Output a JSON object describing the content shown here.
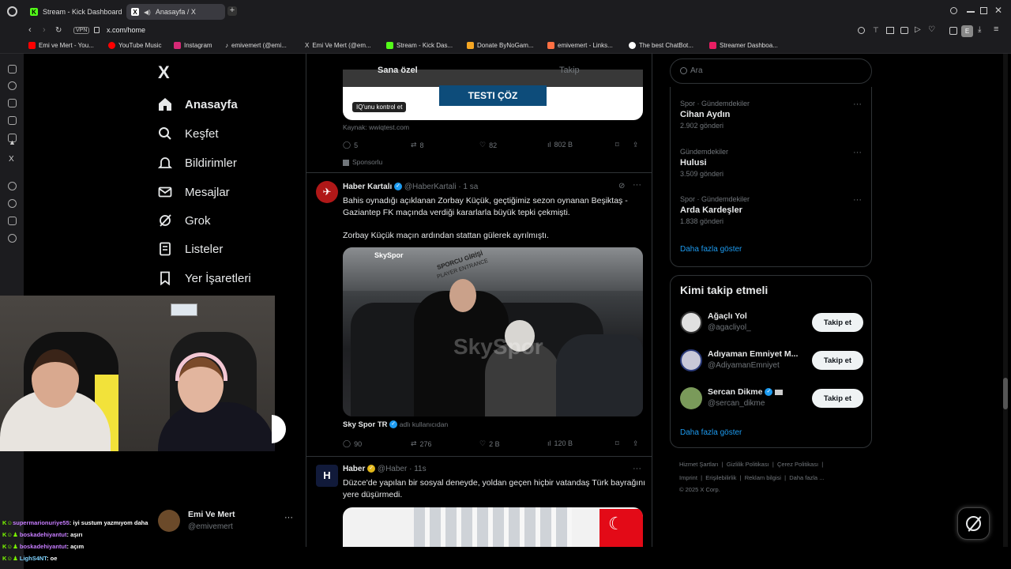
{
  "browser": {
    "tabs": [
      {
        "label": "Stream - Kick Dashboard",
        "active": false
      },
      {
        "label": "Anasayfa / X",
        "active": true
      }
    ],
    "url": "x.com/home",
    "vpn_label": "VPN",
    "profile_initial": "E",
    "bookmarks": [
      {
        "label": "Emi ve Mert - You...",
        "color": "#ff0000"
      },
      {
        "label": "YouTube Music",
        "color": "#ff0000"
      },
      {
        "label": "Instagram",
        "color": "#d62976"
      },
      {
        "label": "emivemert (@emi...",
        "color": "#ffffff"
      },
      {
        "label": "Emi Ve Mert (@em...",
        "color": "#ffffff"
      },
      {
        "label": "Stream - Kick Das...",
        "color": "#53fc18"
      },
      {
        "label": "Donate ByNoGam...",
        "color": "#f5a623"
      },
      {
        "label": "emivemert - Links...",
        "color": "#ff7043"
      },
      {
        "label": "The best ChatBot...",
        "color": "#ffffff"
      },
      {
        "label": "Streamer Dashboa...",
        "color": "#e91e63"
      }
    ]
  },
  "sidebar": {
    "logo": "X",
    "items": [
      {
        "label": "Anasayfa",
        "icon": "home-icon",
        "bold": true
      },
      {
        "label": "Keşfet",
        "icon": "search-icon"
      },
      {
        "label": "Bildirimler",
        "icon": "bell-icon"
      },
      {
        "label": "Mesajlar",
        "icon": "mail-icon"
      },
      {
        "label": "Grok",
        "icon": "grok-icon"
      },
      {
        "label": "Listeler",
        "icon": "list-icon"
      },
      {
        "label": "Yer İşaretleri",
        "icon": "bookmark-icon"
      }
    ]
  },
  "feed": {
    "tabs": [
      {
        "label": "Sana özel",
        "active": true
      },
      {
        "label": "Takip",
        "active": false
      }
    ],
    "ad": {
      "button": "TESTI ÇÖZ",
      "iq_label": "IQ'unu kontrol et",
      "source": "Kaynak: wwiqtest.com",
      "replies": "5",
      "retweets": "8",
      "likes": "82",
      "views": "802 B",
      "sponsored": "Sponsorlu"
    },
    "tweet1": {
      "name": "Haber Kartalı",
      "handle": "@HaberKartali",
      "time": "· 1 sa",
      "text1": "Bahis oynadığı açıklanan Zorbay Küçük, geçtiğimiz sezon oynanan Beşiktaş - Gaziantep FK maçında verdiği kararlarla büyük tepki çekmişti.",
      "text2": "Zorbay Küçük maçın ardından stattan gülerek ayrılmıştı.",
      "media_credit": "Sky Spor TR",
      "media_sub": "adlı kullanıcıdan",
      "watermark": "SkySpor",
      "sign1": "SPORCU GİRİŞİ",
      "sign2": "PLAYER ENTRANCE",
      "replies": "90",
      "retweets": "276",
      "likes": "2 B",
      "views": "120 B"
    },
    "tweet2": {
      "name": "Haber",
      "handle": "@Haber",
      "time": "· 11s",
      "text": "Düzce'de yapılan bir sosyal deneyde, yoldan geçen hiçbir vatandaş Türk bayrağını yere düşürmedi."
    }
  },
  "right": {
    "search_placeholder": "Ara",
    "trends": [
      {
        "meta": "Spor · Gündemdekiler",
        "name": "Cihan Aydın",
        "count": "2.902 gönderi"
      },
      {
        "meta": "Gündemdekiler",
        "name": "Hulusi",
        "count": "3.509 gönderi"
      },
      {
        "meta": "Spor · Gündemdekiler",
        "name": "Arda Kardeşler",
        "count": "1.838 gönderi"
      }
    ],
    "show_more": "Daha fazla göster",
    "who_title": "Kimi takip etmeli",
    "who": [
      {
        "name": "Ağaçlı Yol",
        "handle": "@agacliyol_",
        "button": "Takip et",
        "avatar_color": "#ddd"
      },
      {
        "name": "Adıyaman Emniyet M...",
        "handle": "@AdiyamanEmniyet",
        "button": "Takip et",
        "avatar_color": "#c8c8d8"
      },
      {
        "name": "Sercan Dikme",
        "handle": "@sercan_dikme",
        "button": "Takip et",
        "avatar_color": "#7a9a5a"
      }
    ],
    "who_more": "Daha fazla göster",
    "footer_line1": [
      "Hizmet Şartları",
      "Gizlilik Politikası",
      "Çerez Politikası"
    ],
    "footer_line2": [
      "Imprint",
      "Erişilebilirlik",
      "Reklam bilgisi",
      "Daha fazla ..."
    ],
    "copyright": "© 2025 X Corp."
  },
  "account": {
    "name": "Emi Ve Mert",
    "handle": "@emivemert"
  },
  "chat": [
    {
      "user": "supermarionuriye55",
      "msg": ": iyi sustum yazmıyom daha"
    },
    {
      "user": "boskadehiyantut",
      "msg": ": aşırı"
    },
    {
      "user": "boskadehiyantut",
      "msg": ": açım"
    },
    {
      "user": "LighS4NT",
      "msg": ": oe"
    }
  ],
  "colors": {
    "accent": "#1d9bf0",
    "bg": "#000000",
    "border": "#2f3336",
    "muted": "#71767b"
  }
}
